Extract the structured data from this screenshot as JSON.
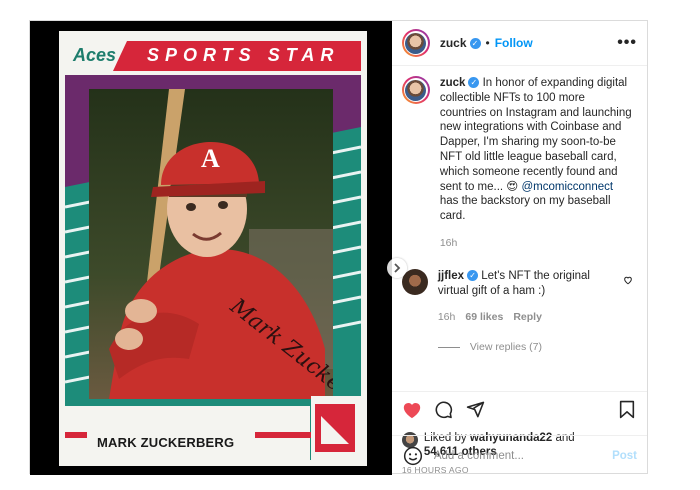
{
  "media": {
    "card_brand": "Aces",
    "card_title": "SPORTS STAR",
    "cap_letter": "A",
    "player_name": "MARK ZUCKERBERG",
    "signature": "Mark Zuckerberg",
    "next_icon": "chevron-right-icon"
  },
  "header": {
    "username": "zuck",
    "dot": "•",
    "follow_label": "Follow",
    "more_label": "•••"
  },
  "caption": {
    "username": "zuck",
    "text_before": "In honor of expanding digital collectible NFTs to 100 more countries on Instagram and launching new integrations with Coinbase and Dapper, I'm sharing my soon-to-be NFT old little league baseball card, which someone recently found and sent to me... 😍 ",
    "mention": "@mcomicconnect",
    "text_after": " has the backstory on my baseball card.",
    "time": "16h"
  },
  "comment": {
    "username": "jjflex",
    "text": "Let's NFT the original virtual gift of a ham :)",
    "time": "16h",
    "likes": "69 likes",
    "reply_label": "Reply",
    "view_replies": "View replies (7)"
  },
  "likes": {
    "prefix": "Liked by ",
    "user": "wahyunanda22",
    "and": " and",
    "others": "54,611 others"
  },
  "timeago": "16 HOURS AGO",
  "add_comment": {
    "placeholder": "Add a comment...",
    "post_label": "Post"
  },
  "colors": {
    "like_red": "#ed4956",
    "follow_blue": "#0095f6",
    "verified_blue": "#3897f0",
    "card_red": "#d6263a",
    "card_teal": "#1d8c7a",
    "card_purple": "#6b2a6b"
  }
}
